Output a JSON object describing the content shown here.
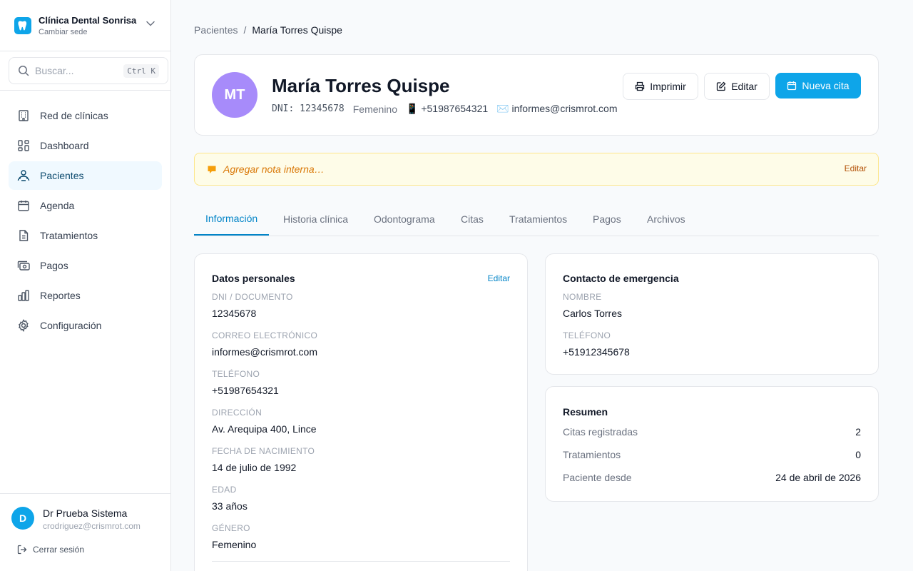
{
  "clinic": {
    "name": "Clínica Dental Sonrisa",
    "switch_label": "Cambiar sede"
  },
  "search": {
    "placeholder": "Buscar...",
    "shortcut": "Ctrl K"
  },
  "nav": [
    {
      "label": "Red de clínicas",
      "icon": "building-icon",
      "active": false
    },
    {
      "label": "Dashboard",
      "icon": "dashboard-icon",
      "active": false
    },
    {
      "label": "Pacientes",
      "icon": "patients-icon",
      "active": true
    },
    {
      "label": "Agenda",
      "icon": "calendar-icon",
      "active": false
    },
    {
      "label": "Tratamientos",
      "icon": "document-icon",
      "active": false
    },
    {
      "label": "Pagos",
      "icon": "payments-icon",
      "active": false
    },
    {
      "label": "Reportes",
      "icon": "bar-chart-icon",
      "active": false
    },
    {
      "label": "Configuración",
      "icon": "gear-icon",
      "active": false
    }
  ],
  "user": {
    "initial": "D",
    "name": "Dr Prueba Sistema",
    "email": "crodriguez@crismrot.com",
    "logout_label": "Cerrar sesión"
  },
  "breadcrumb": {
    "parent": "Pacientes",
    "separator": "/",
    "current": "María Torres Quispe"
  },
  "patient": {
    "initials": "MT",
    "name": "María Torres Quispe",
    "dni_display": "DNI: 12345678",
    "gender": "Femenino",
    "phone_display": "📱 +51987654321",
    "email_display": "✉️ informes@crismrot.com",
    "avatar_color": "#a78bfa"
  },
  "actions": {
    "print_label": "Imprimir",
    "edit_label": "Editar",
    "new_appointment_label": "Nueva cita"
  },
  "note": {
    "placeholder": "Agregar nota interna…",
    "edit_label": "Editar"
  },
  "tabs": [
    "Información",
    "Historia clínica",
    "Odontograma",
    "Citas",
    "Tratamientos",
    "Pagos",
    "Archivos"
  ],
  "active_tab": "Información",
  "personal": {
    "title": "Datos personales",
    "edit_label": "Editar",
    "fields": [
      {
        "label": "DNI / Documento",
        "value": "12345678"
      },
      {
        "label": "Correo electrónico",
        "value": "informes@crismrot.com"
      },
      {
        "label": "Teléfono",
        "value": "+51987654321"
      },
      {
        "label": "Dirección",
        "value": "Av. Arequipa 400, Lince"
      },
      {
        "label": "Fecha de nacimiento",
        "value": "14 de julio de 1992"
      },
      {
        "label": "Edad",
        "value": "33 años"
      },
      {
        "label": "Género",
        "value": "Femenino"
      }
    ]
  },
  "emergency": {
    "title": "Contacto de emergencia",
    "fields": [
      {
        "label": "Nombre",
        "value": "Carlos Torres"
      },
      {
        "label": "Teléfono",
        "value": "+51912345678"
      }
    ]
  },
  "summary": {
    "title": "Resumen",
    "rows": [
      {
        "label": "Citas registradas",
        "value": "2"
      },
      {
        "label": "Tratamientos",
        "value": "0"
      },
      {
        "label": "Paciente desde",
        "value": "24 de abril de 2026"
      }
    ]
  },
  "colors": {
    "primary": "#0ea5e9",
    "active_text": "#0284c7",
    "note_bg": "#fefce8"
  }
}
